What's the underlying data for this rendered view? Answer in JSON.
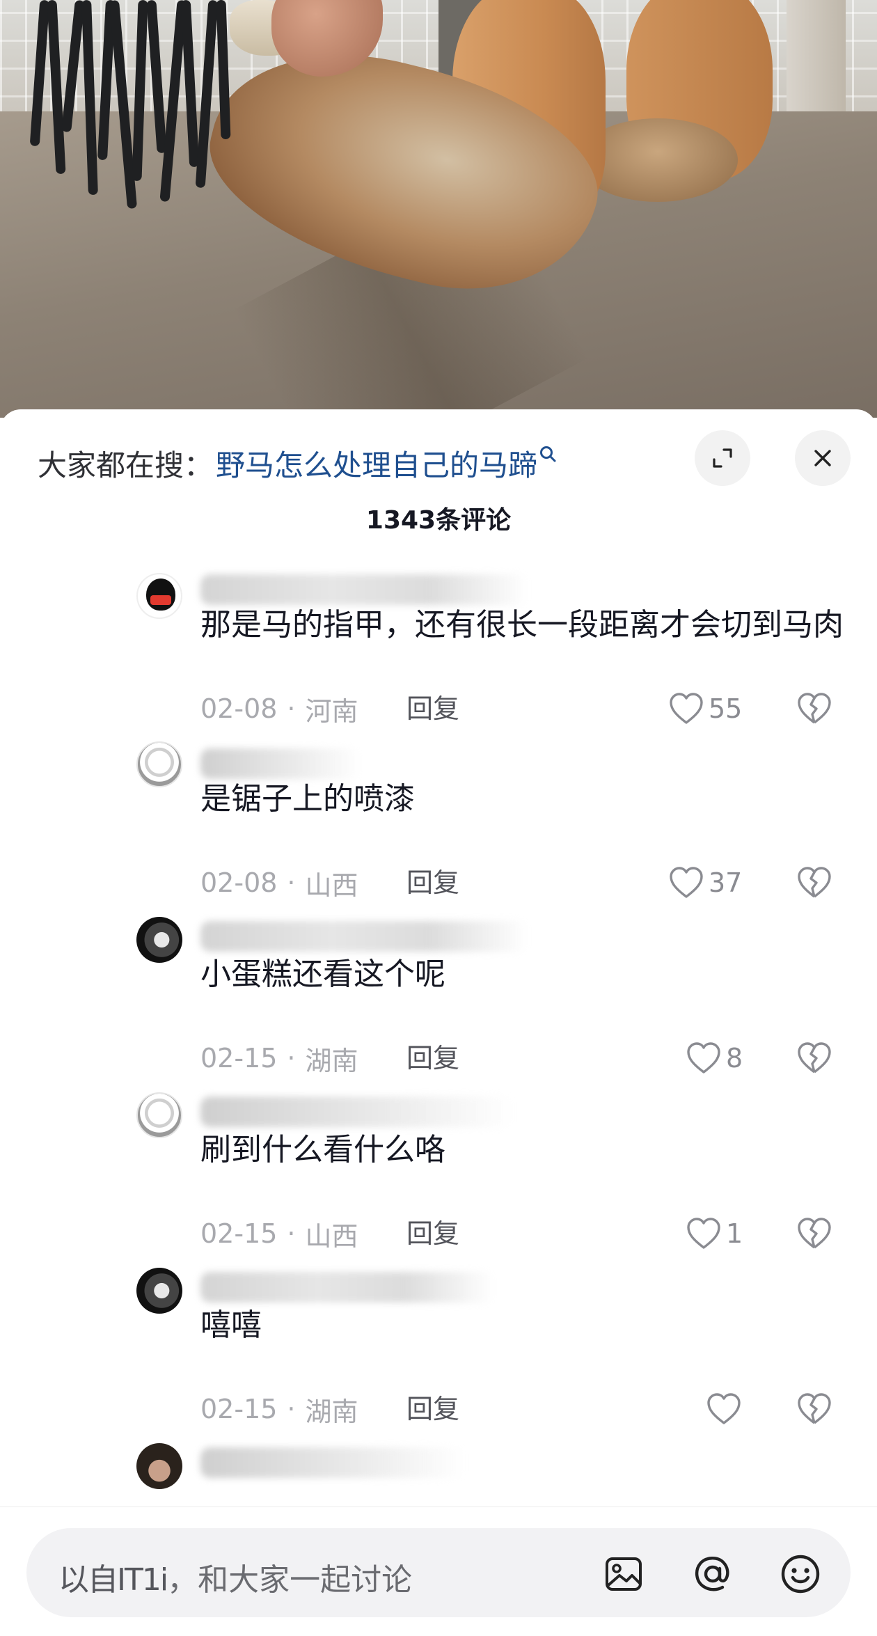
{
  "search": {
    "prefix": "大家都在搜：",
    "query": "野马怎么处理自己的马蹄",
    "search_icon": "search-icon",
    "expand_icon": "expand-icon",
    "close_icon": "close-icon"
  },
  "comments_count": "1343条评论",
  "comments": [
    {
      "avatar": "penguin",
      "text": "那是马的指甲，还有很长一段距离才会切到马肉",
      "date": "02-08",
      "region": "河南",
      "reply": "回复",
      "likes": "55"
    },
    {
      "avatar": "sketch",
      "text": "是锯子上的喷漆",
      "date": "02-08",
      "region": "山西",
      "reply": "回复",
      "likes": "37"
    },
    {
      "avatar": "dark",
      "text": "小蛋糕还看这个呢",
      "date": "02-15",
      "region": "湖南",
      "reply": "回复",
      "likes": "8"
    },
    {
      "avatar": "sketch",
      "text": "刷到什么看什么咯",
      "date": "02-15",
      "region": "山西",
      "reply": "回复",
      "likes": "1"
    },
    {
      "avatar": "dark",
      "text": "嘻嘻",
      "date": "02-15",
      "region": "湖南",
      "reply": "回复",
      "likes": ""
    }
  ],
  "meta_separator": "·",
  "input": {
    "placeholder_prefix": "以自IT1i",
    "placeholder": "，和大家一起讨论",
    "icons": [
      "image-icon",
      "at-icon",
      "emoji-icon"
    ]
  },
  "colors": {
    "query_link": "#1f4f8f",
    "meta_gray": "#a8a9ae",
    "text": "#161823"
  }
}
